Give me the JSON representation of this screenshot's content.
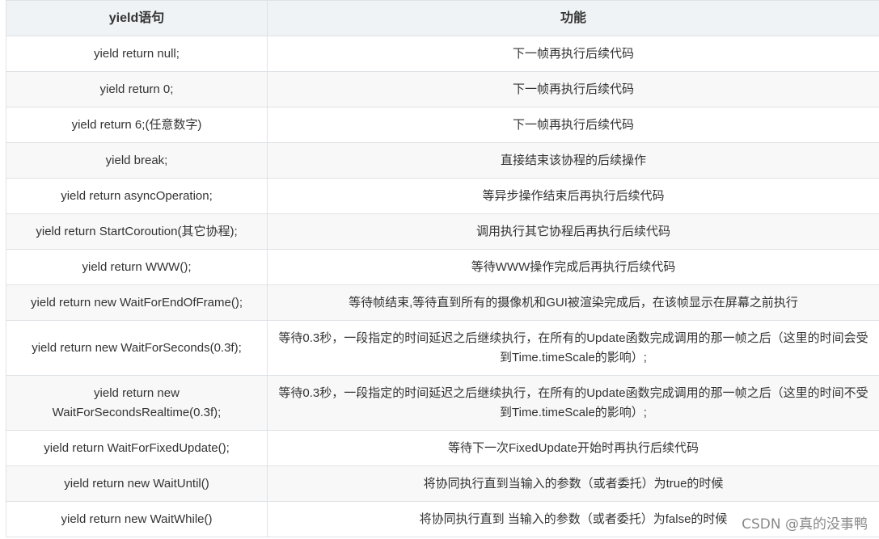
{
  "table": {
    "headers": [
      "yield语句",
      "功能"
    ],
    "rows": [
      [
        "yield return null;",
        "下一帧再执行后续代码"
      ],
      [
        "yield return 0;",
        "下一帧再执行后续代码"
      ],
      [
        "yield return 6;(任意数字)",
        "下一帧再执行后续代码"
      ],
      [
        "yield break;",
        "直接结束该协程的后续操作"
      ],
      [
        "yield return asyncOperation;",
        "等异步操作结束后再执行后续代码"
      ],
      [
        "yield return StartCoroution(其它协程);",
        "调用执行其它协程后再执行后续代码"
      ],
      [
        "yield return WWW();",
        "等待WWW操作完成后再执行后续代码"
      ],
      [
        "yield return new WaitForEndOfFrame();",
        "等待帧结束,等待直到所有的摄像机和GUI被渲染完成后，在该帧显示在屏幕之前执行"
      ],
      [
        "yield return new WaitForSeconds(0.3f);",
        "等待0.3秒，一段指定的时间延迟之后继续执行，在所有的Update函数完成调用的那一帧之后（这里的时间会受到Time.timeScale的影响）;"
      ],
      [
        "yield return new WaitForSecondsRealtime(0.3f);",
        "等待0.3秒，一段指定的时间延迟之后继续执行，在所有的Update函数完成调用的那一帧之后（这里的时间不受到Time.timeScale的影响）;"
      ],
      [
        "yield return WaitForFixedUpdate();",
        "等待下一次FixedUpdate开始时再执行后续代码"
      ],
      [
        "yield return new WaitUntil()",
        "将协同执行直到当输入的参数（或者委托）为true的时候"
      ],
      [
        "yield return new WaitWhile()",
        "将协同执行直到 当输入的参数（或者委托）为false的时候"
      ]
    ]
  },
  "watermark": "CSDN @真的没事鸭"
}
